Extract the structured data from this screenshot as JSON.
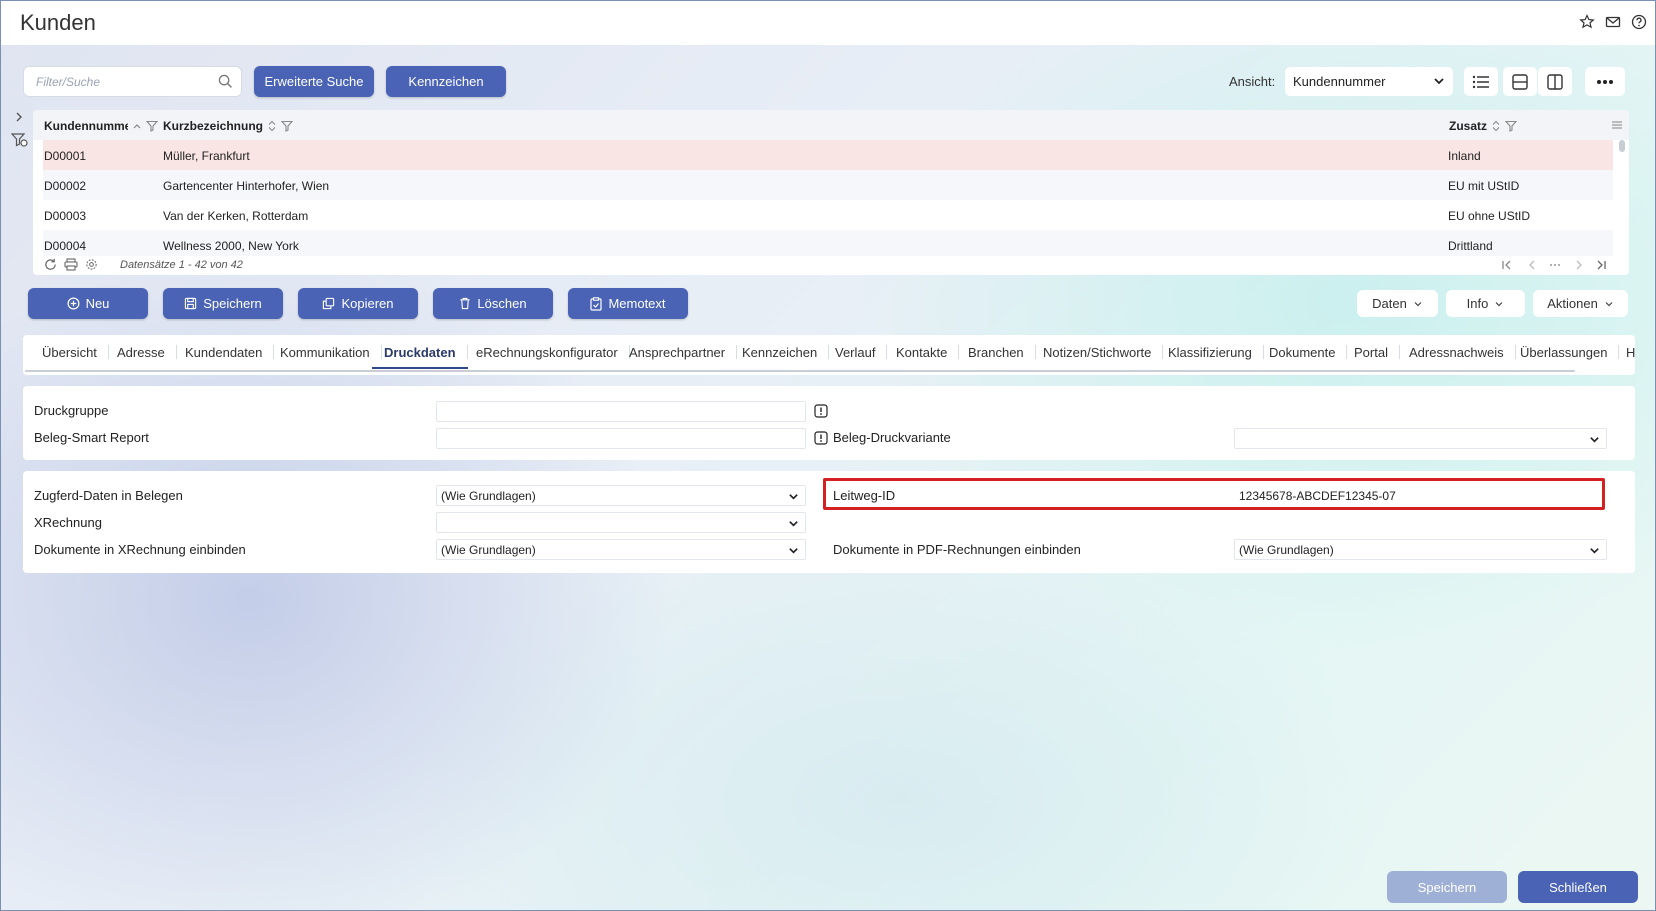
{
  "window": {
    "title": "Kunden"
  },
  "toolbar": {
    "search_placeholder": "Filter/Suche",
    "advanced_search_label": "Erweiterte Suche",
    "kennzeichen_label": "Kennzeichen",
    "ansicht_label": "Ansicht:",
    "ansicht_value": "Kundennummer"
  },
  "grid": {
    "columns": [
      "Kundennummer",
      "Kurzbezeichnung",
      "Zusatz"
    ],
    "rows": [
      {
        "nr": "D00001",
        "name": "Müller, Frankfurt",
        "zusatz": "Inland"
      },
      {
        "nr": "D00002",
        "name": "Gartencenter Hinterhofer, Wien",
        "zusatz": "EU mit UStID"
      },
      {
        "nr": "D00003",
        "name": "Van der Kerken, Rotterdam",
        "zusatz": "EU ohne UStID"
      },
      {
        "nr": "D00004",
        "name": "Wellness 2000, New York",
        "zusatz": "Drittland"
      }
    ],
    "record_count": "Datensätze 1 - 42 von 42"
  },
  "actions": {
    "neu": "Neu",
    "speichern": "Speichern",
    "kopieren": "Kopieren",
    "loeschen": "Löschen",
    "memotext": "Memotext",
    "daten": "Daten",
    "info": "Info",
    "aktionen": "Aktionen"
  },
  "tabs": [
    "Übersicht",
    "Adresse",
    "Kundendaten",
    "Kommunikation",
    "Druckdaten",
    "eRechnungskonfigurator",
    "Ansprechpartner",
    "Kennzeichen",
    "Verlauf",
    "Kontakte",
    "Branchen",
    "Notizen/Stichworte",
    "Klassifizierung",
    "Dokumente",
    "Portal",
    "Adressnachweis",
    "Überlassungen",
    "His"
  ],
  "form1": {
    "druckgruppe_label": "Druckgruppe",
    "druckgruppe_value": "",
    "smart_report_label": "Beleg-Smart Report",
    "smart_report_value": "",
    "druckvariante_label": "Beleg-Druckvariante",
    "druckvariante_value": ""
  },
  "form2": {
    "zugferd_label": "Zugferd-Daten in Belegen",
    "zugferd_value": "(Wie Grundlagen)",
    "xrechnung_label": "XRechnung",
    "xrechnung_value": "",
    "dok_xrechnung_label": "Dokumente in XRechnung einbinden",
    "dok_xrechnung_value": "(Wie Grundlagen)",
    "leitweg_label": "Leitweg-ID",
    "leitweg_value": "12345678-ABCDEF12345-07",
    "dok_pdf_label": "Dokumente in PDF-Rechnungen einbinden",
    "dok_pdf_value": "(Wie Grundlagen)"
  },
  "footer": {
    "speichern": "Speichern",
    "schliessen": "Schließen"
  },
  "colors": {
    "primary": "#4a63b5",
    "selected_row": "#f9e6e4",
    "highlight": "#d32020"
  }
}
